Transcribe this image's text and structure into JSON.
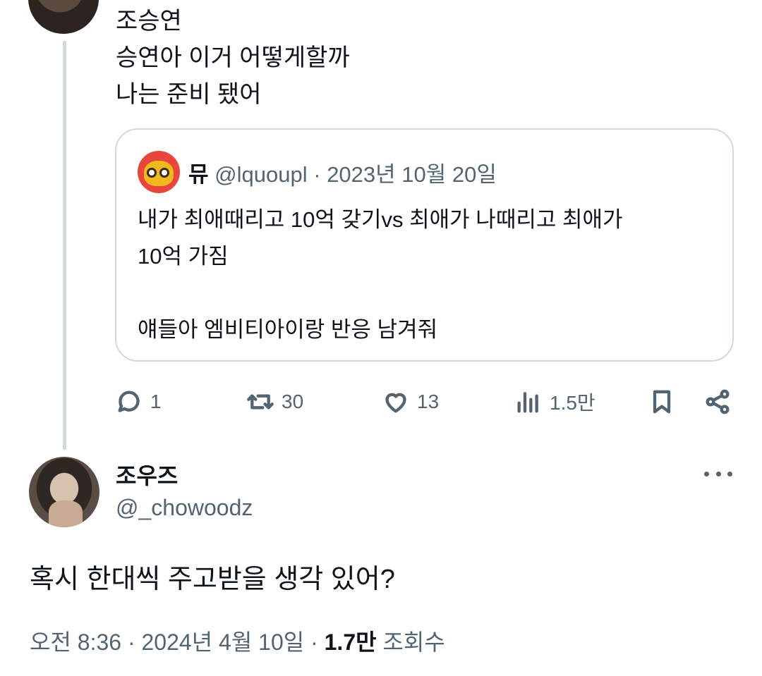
{
  "parent_tweet": {
    "author": "조승연",
    "lines": [
      "승연아 이거 어떻게할까",
      "나는 준비 됐어"
    ]
  },
  "quote": {
    "name": "뮤",
    "handle": "@lquoupl",
    "separator": "·",
    "date": "2023년 10월 20일",
    "lines": [
      "내가 최애때리고 10억 갖기vs 최애가 나때리고 최애가",
      "10억 가짐",
      "",
      "얘들아 엠비티아이랑 반응 남겨줘"
    ]
  },
  "actions": {
    "replies": "1",
    "reposts": "30",
    "likes": "13",
    "views": "1.5만"
  },
  "tweet": {
    "name": "조우즈",
    "handle": "@_chowoodz",
    "text": "혹시 한대씩 주고받을 생각 있어?",
    "time": "오전 8:36",
    "separator": "·",
    "date": "2024년 4월 10일",
    "views_count": "1.7만",
    "views_label": "조회수"
  },
  "colors": {
    "text": "#0f1419",
    "secondary": "#536471",
    "border": "#cfd9de"
  }
}
